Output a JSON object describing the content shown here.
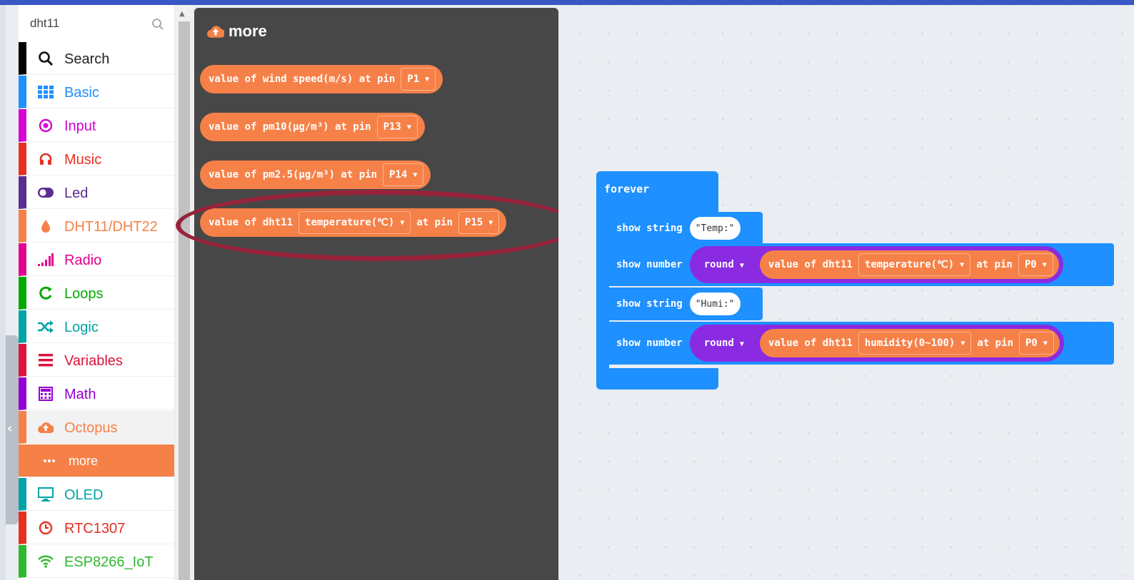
{
  "search": {
    "value": "dht11"
  },
  "categories": [
    {
      "label": "Search",
      "color": "#000000",
      "text_color": "#222222",
      "icon": "search-icon"
    },
    {
      "label": "Basic",
      "color": "#1e90ff",
      "text_color": "#1e90ff",
      "icon": "grid-icon"
    },
    {
      "label": "Input",
      "color": "#d400d4",
      "text_color": "#d400d4",
      "icon": "radio-button-icon"
    },
    {
      "label": "Music",
      "color": "#e63022",
      "text_color": "#e63022",
      "icon": "headphones-icon"
    },
    {
      "label": "Led",
      "color": "#5c2d91",
      "text_color": "#5c2d91",
      "icon": "toggle-icon"
    },
    {
      "label": "DHT11/DHT22",
      "color": "#f58149",
      "text_color": "#f58149",
      "icon": "droplet-icon"
    },
    {
      "label": "Radio",
      "color": "#e3008c",
      "text_color": "#e3008c",
      "icon": "signal-bars-icon"
    },
    {
      "label": "Loops",
      "color": "#00aa00",
      "text_color": "#00aa00",
      "icon": "loop-arrow-icon"
    },
    {
      "label": "Logic",
      "color": "#00a4a6",
      "text_color": "#00a4a6",
      "icon": "shuffle-icon"
    },
    {
      "label": "Variables",
      "color": "#dc143c",
      "text_color": "#dc143c",
      "icon": "lines-icon"
    },
    {
      "label": "Math",
      "color": "#9400d3",
      "text_color": "#9400d3",
      "icon": "calculator-icon"
    },
    {
      "label": "Octopus",
      "color": "#f58149",
      "text_color": "#f58149",
      "icon": "cloud-upload-icon"
    },
    {
      "label": "more",
      "color": "#f58149",
      "text_color": "#ffffff",
      "icon": "dots-icon"
    },
    {
      "label": "OLED",
      "color": "#00a4a6",
      "text_color": "#00a4a6",
      "icon": "monitor-icon"
    },
    {
      "label": "RTC1307",
      "color": "#e63022",
      "text_color": "#e63022",
      "icon": "clock-icon"
    },
    {
      "label": "ESP8266_IoT",
      "color": "#2fb82f",
      "text_color": "#2fb82f",
      "icon": "wifi-icon"
    }
  ],
  "flyout": {
    "title": "more",
    "blocks": [
      {
        "text": "value of wind speed(m/s) at pin",
        "pin": "P1"
      },
      {
        "text": "value of pm10(μg/m³) at pin",
        "pin": "P13"
      },
      {
        "text": "value of pm2.5(μg/m³) at pin",
        "pin": "P14"
      },
      {
        "prefix": "value of dht11",
        "option": "temperature(℃)",
        "mid": "at pin",
        "pin": "P15"
      }
    ]
  },
  "program": {
    "forever_label": "forever",
    "show_string_label": "show string",
    "show_number_label": "show number",
    "round_label": "round",
    "value_label": "value of dht11",
    "at_pin_label": "at pin",
    "stmt1_value": "\"Temp:\"",
    "stmt2_option": "temperature(℃)",
    "stmt2_pin": "P0",
    "stmt3_value": "\"Humi:\"",
    "stmt4_option": "humidity(0~100)",
    "stmt4_pin": "P0"
  },
  "colors": {
    "accent_blue": "#1e90ff",
    "block_orange": "#f58149",
    "round_purple": "#8a2be2",
    "highlight": "#97233b"
  }
}
